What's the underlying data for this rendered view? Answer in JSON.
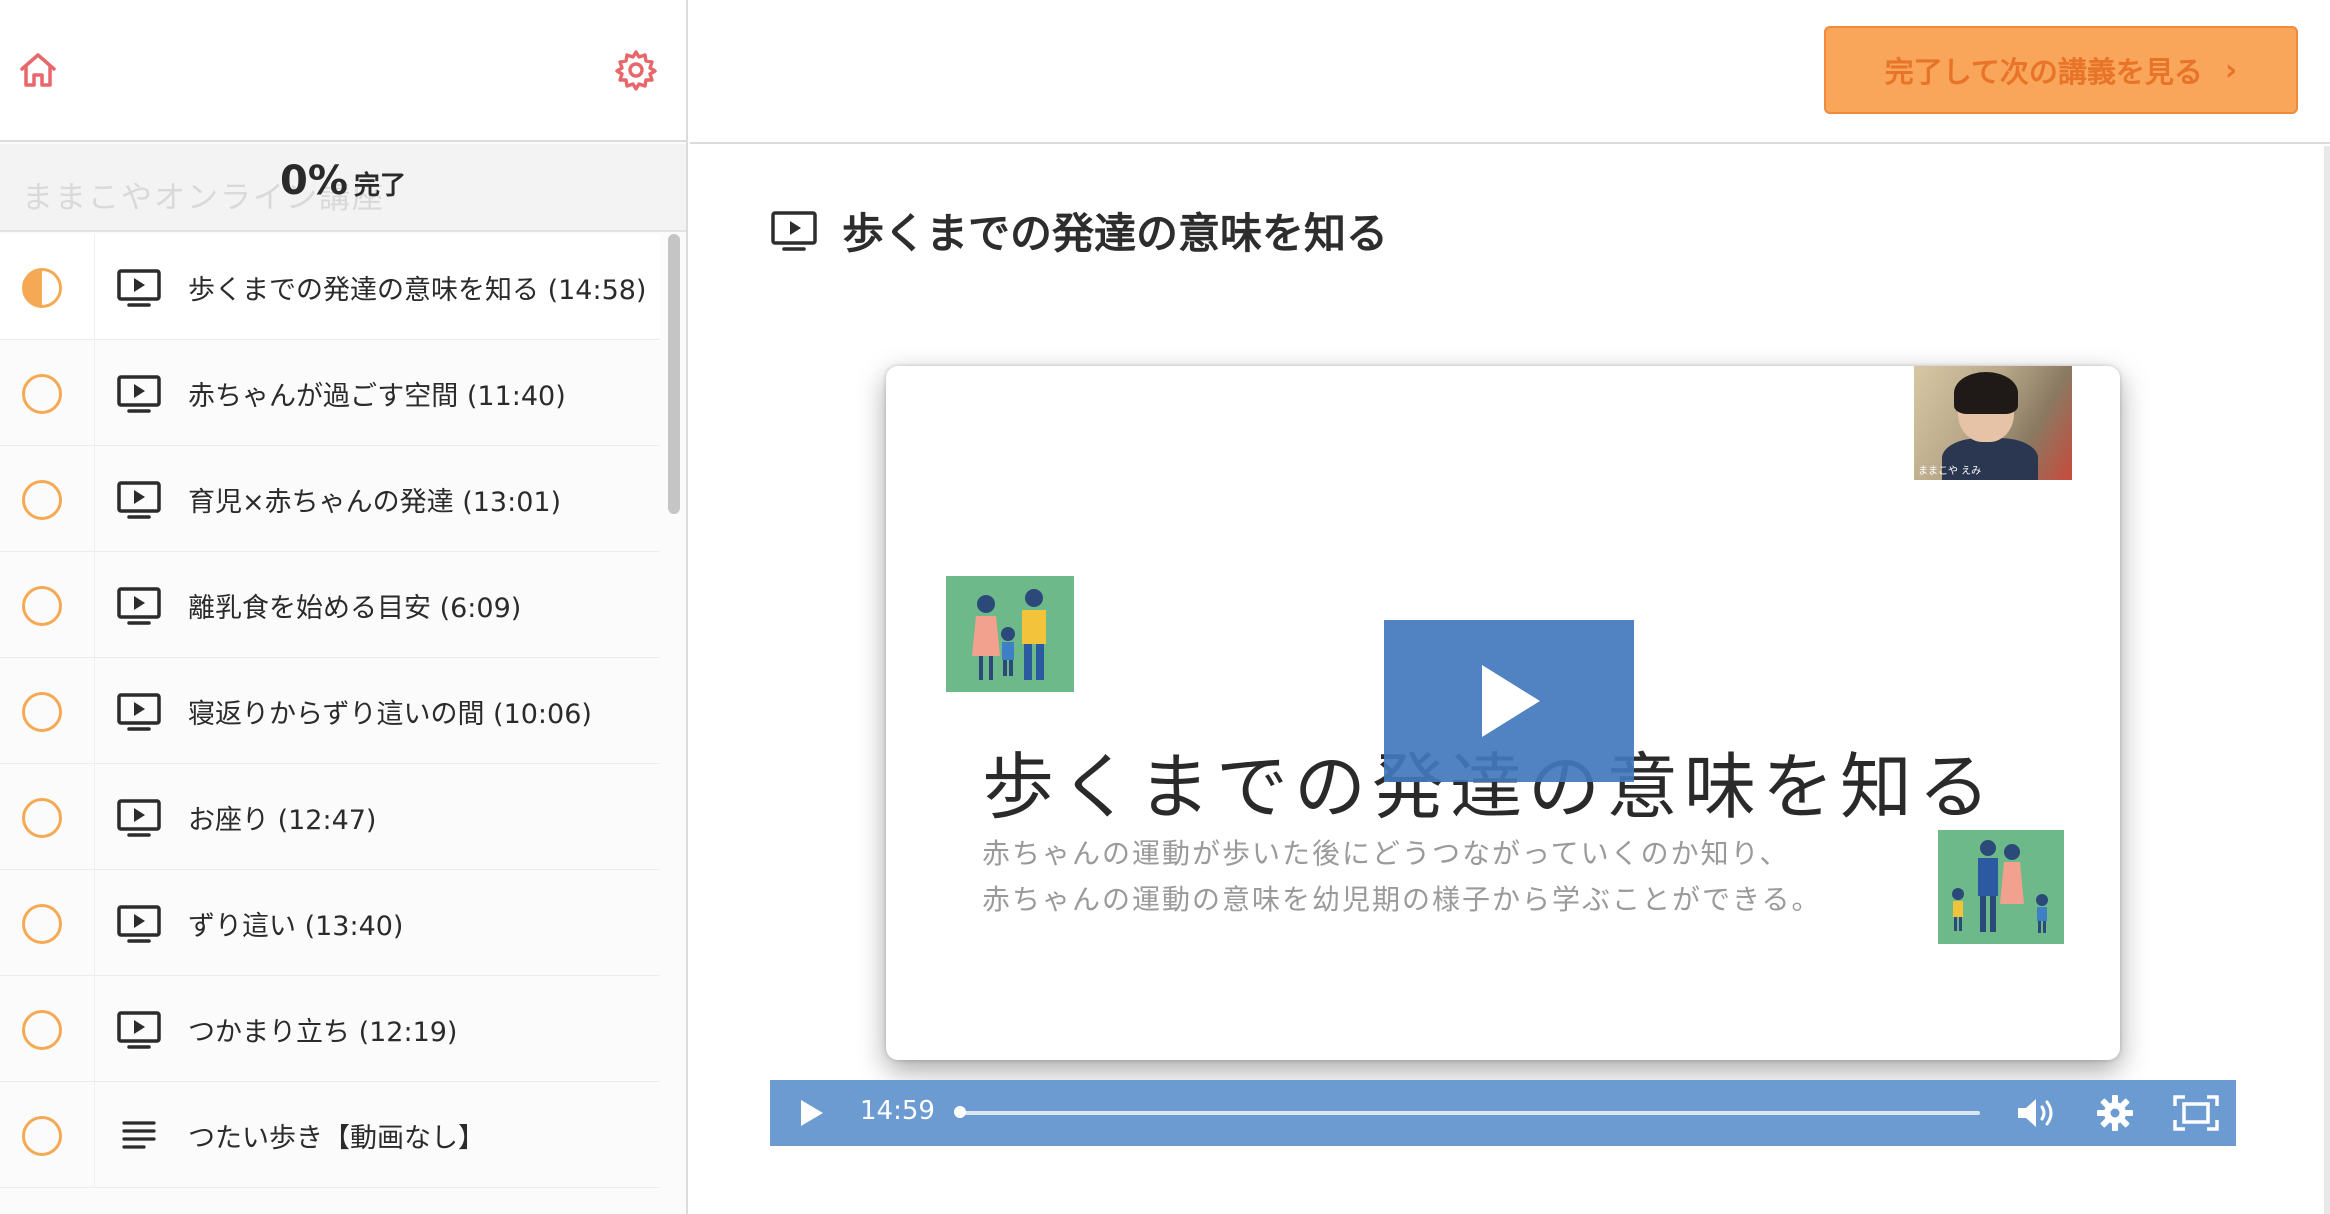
{
  "colors": {
    "accent_orange": "#f6a954",
    "button_bg": "#f9a65a",
    "button_text": "#e8742a",
    "player_blue": "#6b9bd0",
    "play_overlay": "#4278be",
    "icon_red": "#e8676a"
  },
  "header": {
    "home_icon": "home-icon",
    "settings_icon": "gear-icon",
    "next_button_label": "完了して次の講義を見る",
    "next_button_chevron": "›"
  },
  "progress": {
    "percent_text": "0%",
    "label": "完了",
    "course_name_faded": "ままこやオンライン講座"
  },
  "lectures": [
    {
      "title": "歩くまでの発達の意味を知る (14:58)",
      "type": "video",
      "status": "in-progress"
    },
    {
      "title": "赤ちゃんが過ごす空間 (11:40)",
      "type": "video",
      "status": "not-started"
    },
    {
      "title": "育児×赤ちゃんの発達 (13:01)",
      "type": "video",
      "status": "not-started"
    },
    {
      "title": "離乳食を始める目安 (6:09)",
      "type": "video",
      "status": "not-started"
    },
    {
      "title": "寝返りからずり這いの間 (10:06)",
      "type": "video",
      "status": "not-started"
    },
    {
      "title": "お座り (12:47)",
      "type": "video",
      "status": "not-started"
    },
    {
      "title": "ずり這い (13:40)",
      "type": "video",
      "status": "not-started"
    },
    {
      "title": "つかまり立ち (12:19)",
      "type": "video",
      "status": "not-started"
    },
    {
      "title": "つたい歩き【動画なし】",
      "type": "text",
      "status": "not-started"
    }
  ],
  "main": {
    "lecture_title": "歩くまでの発達の意味を知る",
    "slide": {
      "title": "歩くまでの発達の意味を知る",
      "subtitle_line1": "赤ちゃんの運動が歩いた後にどうつながっていくのか知り、",
      "subtitle_line2": "赤ちゃんの運動の意味を幼児期の様子から学ぶことができる。",
      "webcam_label": "ままこや えみ"
    },
    "player": {
      "time": "14:59",
      "progress": 0.0
    }
  }
}
